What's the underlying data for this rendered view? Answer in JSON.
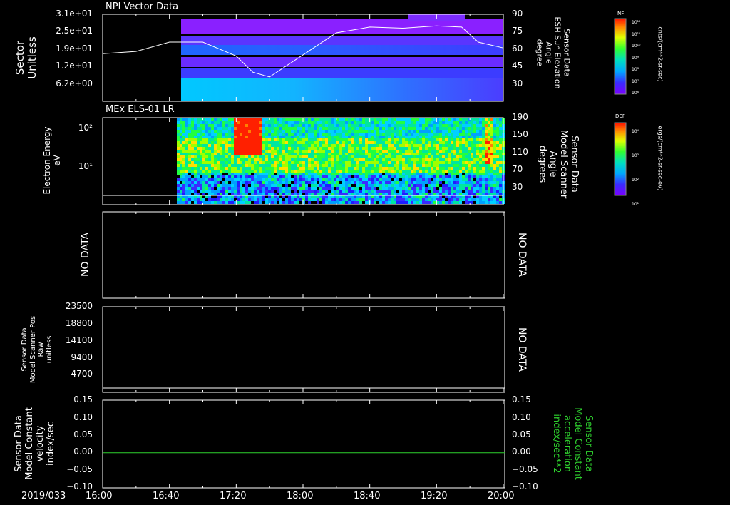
{
  "chart_data": [
    {
      "type": "heatmap",
      "title": "NPI Vector Data",
      "ylabel_left": [
        "Sector",
        "Unitless"
      ],
      "left_ticks": [
        "3.1e+01",
        "2.5e+01",
        "1.9e+01",
        "1.2e+01",
        "6.2e+00"
      ],
      "ylabel_right": [
        "Sensor Data",
        "ESH Sun Elevation",
        "Angle",
        "degree"
      ],
      "right_ticks": [
        "90",
        "75",
        "60",
        "45",
        "30"
      ],
      "right_ylim": [
        15,
        90
      ],
      "colorbar": {
        "label": "NF",
        "unit": "cnts/(cm**2-sr-sec)",
        "ticks": [
          "10¹²",
          "10¹¹",
          "10¹⁰",
          "10⁹",
          "10⁸",
          "10⁷",
          "10⁶"
        ]
      },
      "line_series": {
        "x": [
          "16:00",
          "16:20",
          "16:40",
          "16:50",
          "17:00",
          "17:20",
          "17:30",
          "17:40",
          "18:00",
          "18:20",
          "18:40",
          "19:00",
          "19:20",
          "19:35",
          "19:45",
          "20:00"
        ],
        "y": [
          56,
          58,
          66,
          66,
          66,
          54,
          40,
          36,
          55,
          74,
          79,
          78,
          80,
          79,
          66,
          61
        ]
      }
    },
    {
      "type": "heatmap",
      "title": "MEx ELS-01 LR",
      "ylabel_left": [
        "Electron Energy",
        "eV"
      ],
      "left_ticks": [
        "10²",
        "10¹"
      ],
      "ylabel_right": [
        "Sensor Data",
        "Model Scanner",
        "Angle",
        "degrees"
      ],
      "right_ticks": [
        "190",
        "150",
        "110",
        "70",
        "30"
      ],
      "colorbar": {
        "label": "DEF",
        "unit": "ergs/(cm**2-sr-sec-eV)",
        "ticks": [
          "10⁴",
          "10³",
          "10²",
          "10¹"
        ]
      }
    },
    {
      "type": "line",
      "no_data_left": "NO DATA",
      "no_data_right": "NO DATA"
    },
    {
      "type": "line",
      "ylabel_left": [
        "Sensor Data",
        "Model Scanner Pos",
        "Raw",
        "unitless"
      ],
      "left_ticks": [
        "23500",
        "18800",
        "14100",
        "9400",
        "4700"
      ],
      "no_data_right": "NO DATA"
    },
    {
      "type": "line",
      "ylabel_left": [
        "Sensor Data",
        "Model Constant",
        "velocity",
        "index/sec"
      ],
      "left_ticks": [
        "0.15",
        "0.10",
        "0.05",
        "0.00",
        "−0.05",
        "−0.10"
      ],
      "ylabel_right": [
        "Sensor Data",
        "Model Constant",
        "acceleration",
        "index/sec**2"
      ],
      "right_ticks": [
        "0.15",
        "0.10",
        "0.05",
        "0.00",
        "−0.05",
        "−0.10"
      ],
      "ylim": [
        -0.1,
        0.15
      ],
      "series": [
        {
          "x": [
            "16:00",
            "20:00"
          ],
          "values": [
            0.0,
            0.0
          ],
          "color": "#2ed12e"
        }
      ]
    }
  ],
  "x_axis": {
    "date": "2019/033",
    "ticks": [
      "16:00",
      "16:40",
      "17:20",
      "18:00",
      "18:40",
      "19:20",
      "20:00"
    ]
  }
}
